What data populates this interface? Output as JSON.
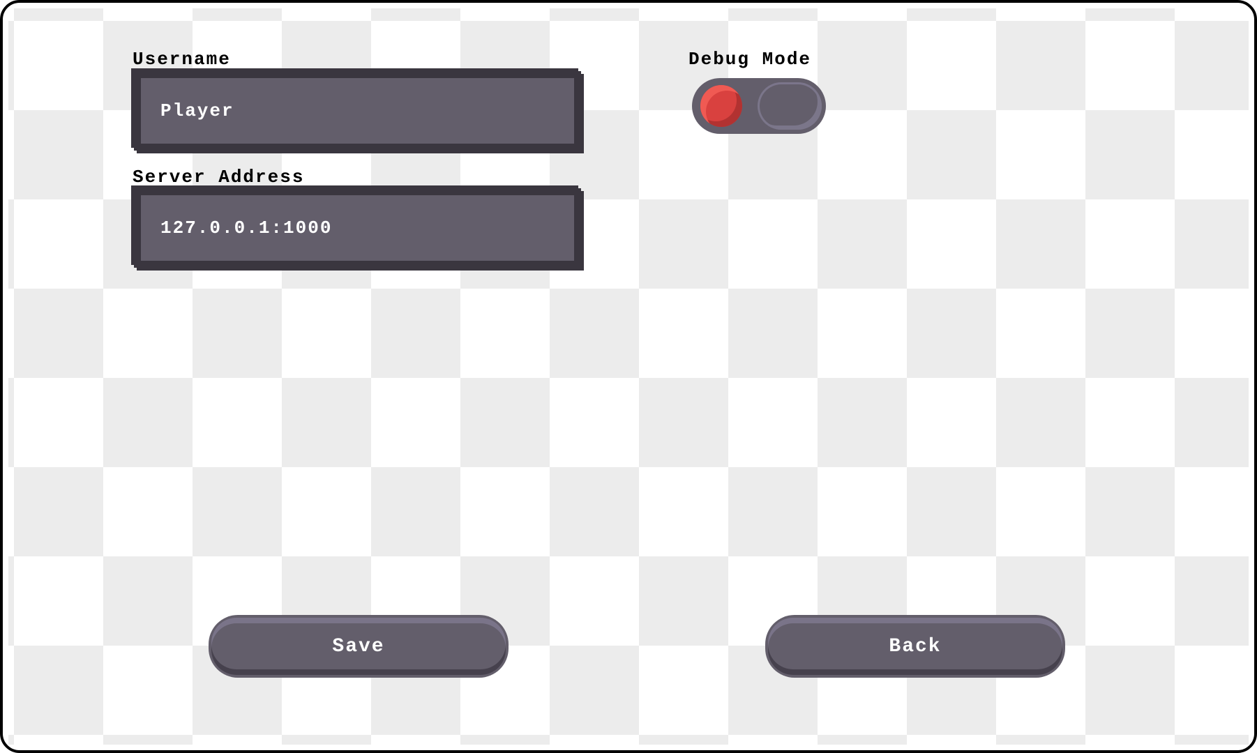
{
  "settings": {
    "username_label": "Username",
    "username_value": "Player",
    "server_label": "Server Address",
    "server_value": "127.0.0.1:1000",
    "debug_label": "Debug Mode",
    "debug_on": false
  },
  "buttons": {
    "save": "Save",
    "back": "Back"
  },
  "colors": {
    "panel": "#635e6b",
    "panel_border": "#3a363f",
    "toggle_knob": "#d9413f",
    "checker_light": "#ffffff",
    "checker_dark": "#ececec"
  }
}
